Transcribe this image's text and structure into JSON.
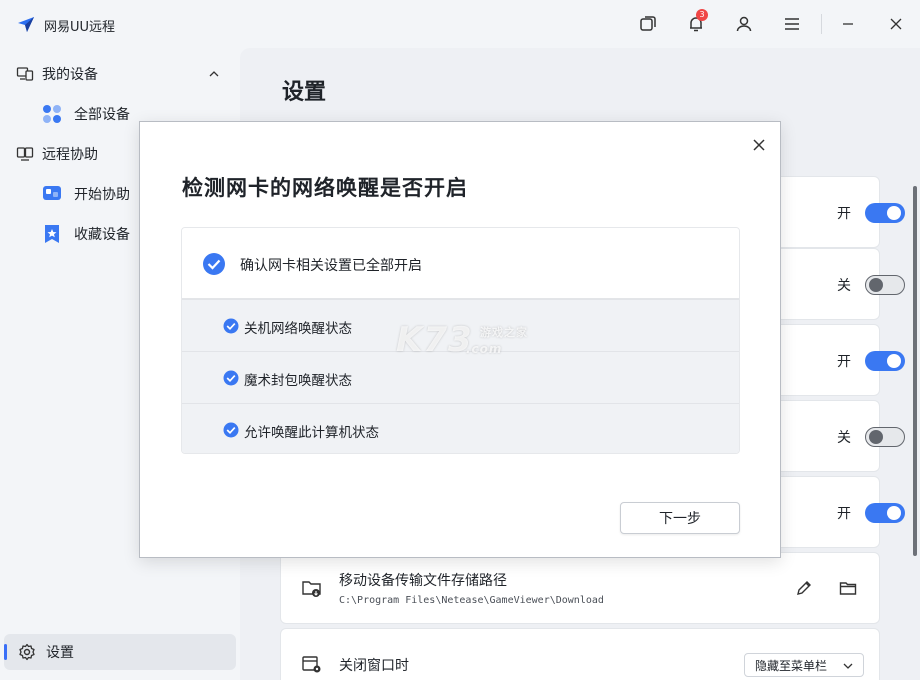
{
  "app": {
    "title": "网易UU远程",
    "notification_count": "3"
  },
  "sidebar": {
    "groups": [
      {
        "label": "我的设备",
        "items": [
          {
            "label": "全部设备"
          }
        ]
      },
      {
        "label": "远程协助",
        "items": [
          {
            "label": "开始协助"
          },
          {
            "label": "收藏设备"
          }
        ]
      }
    ],
    "settings_label": "设置"
  },
  "main": {
    "title": "设置",
    "toggles": [
      {
        "label": "开",
        "state": "on"
      },
      {
        "label": "关",
        "state": "off"
      },
      {
        "label": "开",
        "state": "on"
      },
      {
        "label": "关",
        "state": "off"
      },
      {
        "label": "开",
        "state": "on"
      }
    ],
    "file_path_row": {
      "title": "移动设备传输文件存储路径",
      "path": "C:\\Program Files\\Netease\\GameViewer\\Download"
    },
    "close_window_row": {
      "title": "关闭窗口时",
      "selected": "隐藏至菜单栏"
    }
  },
  "modal": {
    "title": "检测网卡的网络唤醒是否开启",
    "main_check": "确认网卡相关设置已全部开启",
    "sub_checks": [
      "关机网络唤醒状态",
      "魔术封包唤醒状态",
      "允许唤醒此计算机状态"
    ],
    "next_button": "下一步"
  },
  "watermark": {
    "text": "K73",
    "sub": "游戏之家",
    "domain": ".com"
  },
  "colors": {
    "accent": "#3a78f2",
    "badge": "#f04646"
  }
}
